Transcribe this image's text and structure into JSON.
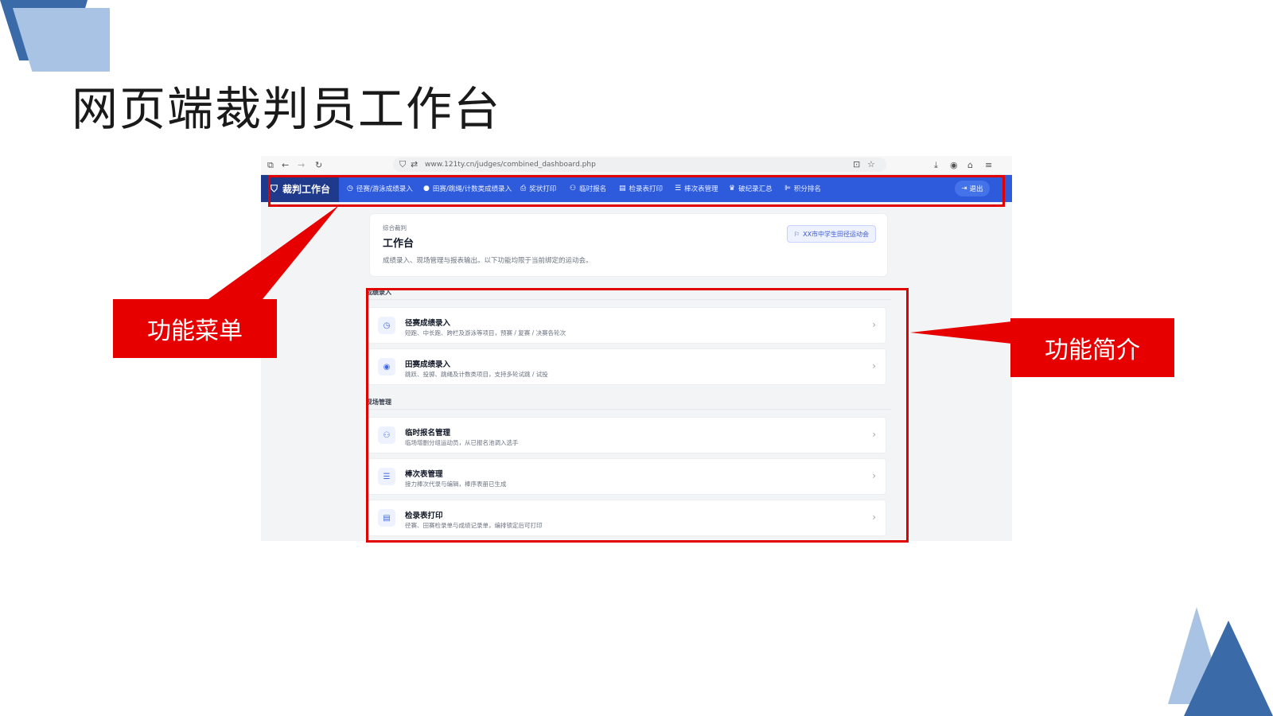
{
  "slide": {
    "title": "网页端裁判员工作台"
  },
  "browser": {
    "url": "www.121ty.cn/judges/combined_dashboard.php"
  },
  "navbar": {
    "brand": "裁判工作台",
    "items": [
      {
        "label": "径赛/游泳成绩录入",
        "icon": "stopwatch-icon"
      },
      {
        "label": "田赛/跳绳/计数类成绩录入",
        "icon": "disc-icon"
      },
      {
        "label": "奖状打印",
        "icon": "printer-icon"
      },
      {
        "label": "临时报名",
        "icon": "user-add-icon"
      },
      {
        "label": "检录表打印",
        "icon": "table-icon"
      },
      {
        "label": "棒次表管理",
        "icon": "list-icon"
      },
      {
        "label": "破纪录汇总",
        "icon": "trophy-icon"
      },
      {
        "label": "积分排名",
        "icon": "ranking-icon"
      }
    ],
    "logout": "退出"
  },
  "header": {
    "kicker": "综合裁判",
    "title": "工作台",
    "description": "成绩录入、现场管理与报表输出。以下功能均限于当前绑定的运动会。",
    "event": "XX市中学生田径运动会"
  },
  "sections": [
    {
      "label": "成绩录入",
      "rows": [
        {
          "title": "径赛成绩录入",
          "desc": "短跑、中长跑、跨栏及游泳等项目，预赛 / 复赛 / 决赛各轮次",
          "icon": "stopwatch-icon"
        },
        {
          "title": "田赛成绩录入",
          "desc": "跳跃、投掷、跳绳及计数类项目，支持多轮试跳 / 试投",
          "icon": "disc-icon"
        }
      ]
    },
    {
      "label": "现场管理",
      "rows": [
        {
          "title": "临时报名管理",
          "desc": "临场增删分组运动员，从已报名池调入选手",
          "icon": "user-add-icon"
        },
        {
          "title": "棒次表管理",
          "desc": "接力棒次代录与编辑，棒序表册已生成",
          "icon": "list-icon"
        },
        {
          "title": "检录表打印",
          "desc": "径赛、田赛检录单与成绩记录单，编排锁定后可打印",
          "icon": "table-icon"
        }
      ]
    }
  ],
  "annotations": {
    "menu_callout": "功能菜单",
    "intro_callout": "功能简介"
  },
  "colors": {
    "navbar": "#2e5bdc",
    "brand": "#1f3a8a",
    "annotation_red": "#e60000",
    "deco_dark": "#3a6aa8",
    "deco_light": "#a9c3e4"
  }
}
